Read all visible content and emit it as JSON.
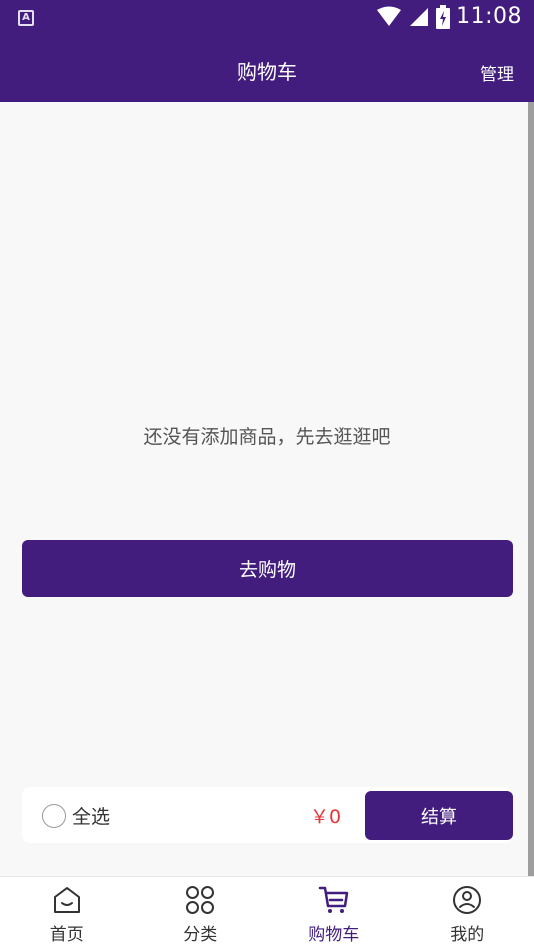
{
  "status_bar": {
    "app_badge": "A",
    "time": "11:08",
    "icons": [
      "wifi-icon",
      "cell-signal-icon",
      "battery-charging-icon"
    ]
  },
  "app_bar": {
    "title": "购物车",
    "manage_label": "管理"
  },
  "empty_state": {
    "message": "还没有添加商品，先去逛逛吧",
    "button_label": "去购物"
  },
  "checkout_bar": {
    "select_all_label": "全选",
    "select_all_checked": false,
    "total": "￥0",
    "checkout_label": "结算"
  },
  "tab_bar": {
    "items": [
      {
        "label": "首页",
        "icon": "home-icon",
        "active": false
      },
      {
        "label": "分类",
        "icon": "category-icon",
        "active": false
      },
      {
        "label": "购物车",
        "icon": "cart-icon",
        "active": true
      },
      {
        "label": "我的",
        "icon": "profile-icon",
        "active": false
      }
    ]
  },
  "colors": {
    "primary": "#431d7e",
    "price": "#e4393c",
    "background": "#f8f8f8"
  }
}
